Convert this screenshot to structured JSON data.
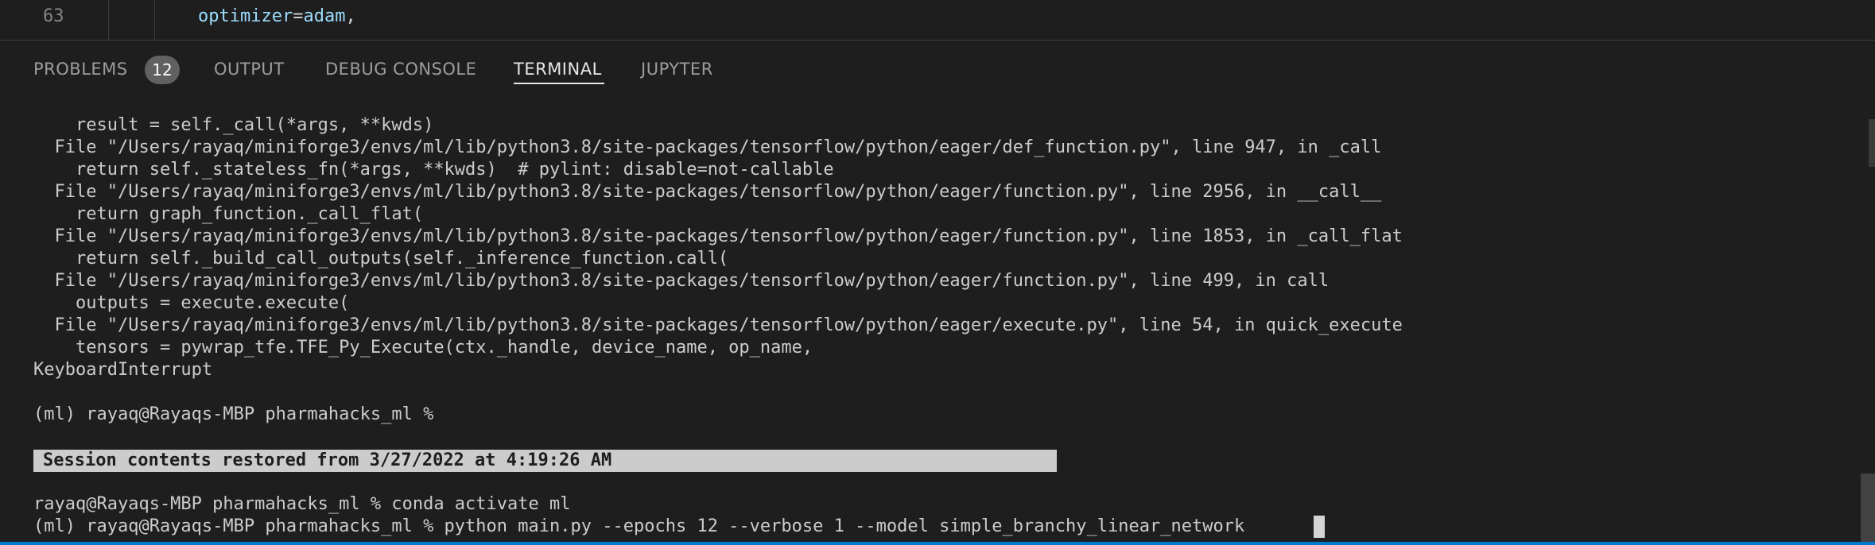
{
  "editor": {
    "line_number": "63",
    "code_param": "optimizer",
    "code_eq": "=",
    "code_value": "adam",
    "code_comma": ","
  },
  "tabs": [
    {
      "label": "PROBLEMS",
      "active": false
    },
    {
      "label": "OUTPUT",
      "active": false
    },
    {
      "label": "DEBUG CONSOLE",
      "active": false
    },
    {
      "label": "TERMINAL",
      "active": true
    },
    {
      "label": "JUPYTER",
      "active": false
    }
  ],
  "problems_badge": "12",
  "terminal": {
    "lines": [
      "    result = self._call(*args, **kwds)",
      "  File \"/Users/rayaq/miniforge3/envs/ml/lib/python3.8/site-packages/tensorflow/python/eager/def_function.py\", line 947, in _call",
      "    return self._stateless_fn(*args, **kwds)  # pylint: disable=not-callable",
      "  File \"/Users/rayaq/miniforge3/envs/ml/lib/python3.8/site-packages/tensorflow/python/eager/function.py\", line 2956, in __call__",
      "    return graph_function._call_flat(",
      "  File \"/Users/rayaq/miniforge3/envs/ml/lib/python3.8/site-packages/tensorflow/python/eager/function.py\", line 1853, in _call_flat",
      "    return self._build_call_outputs(self._inference_function.call(",
      "  File \"/Users/rayaq/miniforge3/envs/ml/lib/python3.8/site-packages/tensorflow/python/eager/function.py\", line 499, in call",
      "    outputs = execute.execute(",
      "  File \"/Users/rayaq/miniforge3/envs/ml/lib/python3.8/site-packages/tensorflow/python/eager/execute.py\", line 54, in quick_execute",
      "    tensors = pywrap_tfe.TFE_Py_Execute(ctx._handle, device_name, op_name,",
      "KeyboardInterrupt",
      "",
      "(ml) rayaq@Rayaqs-MBP pharmahacks_ml % "
    ],
    "restored_message": "Session contents restored from 3/27/2022 at 4:19:26 AM",
    "after_lines": [
      "rayaq@Rayaqs-MBP pharmahacks_ml % conda activate ml",
      "(ml) rayaq@Rayaqs-MBP pharmahacks_ml % python main.py --epochs 12 --verbose 1 --model simple_branchy_linear_network"
    ]
  },
  "colors": {
    "background": "#1e1e1e",
    "text": "#cccccc",
    "accent": "#007acc",
    "badge": "#616161"
  }
}
